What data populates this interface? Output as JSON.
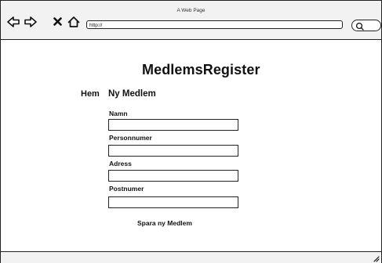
{
  "browser": {
    "window_title": "A Web Page",
    "url": "http://"
  },
  "page": {
    "title": "MedlemsRegister",
    "nav": {
      "home": "Hem"
    },
    "form": {
      "title": "Ny Medlem",
      "fields": [
        {
          "label": "Namn",
          "value": ""
        },
        {
          "label": "Personnumer",
          "value": ""
        },
        {
          "label": "Adress",
          "value": ""
        },
        {
          "label": "Postnumer",
          "value": ""
        }
      ],
      "submit_label": "Spara ny Medlem"
    }
  },
  "icons": [
    "back-arrow-icon",
    "forward-arrow-icon",
    "close-icon",
    "home-icon",
    "search-icon",
    "resize-grip-icon"
  ]
}
